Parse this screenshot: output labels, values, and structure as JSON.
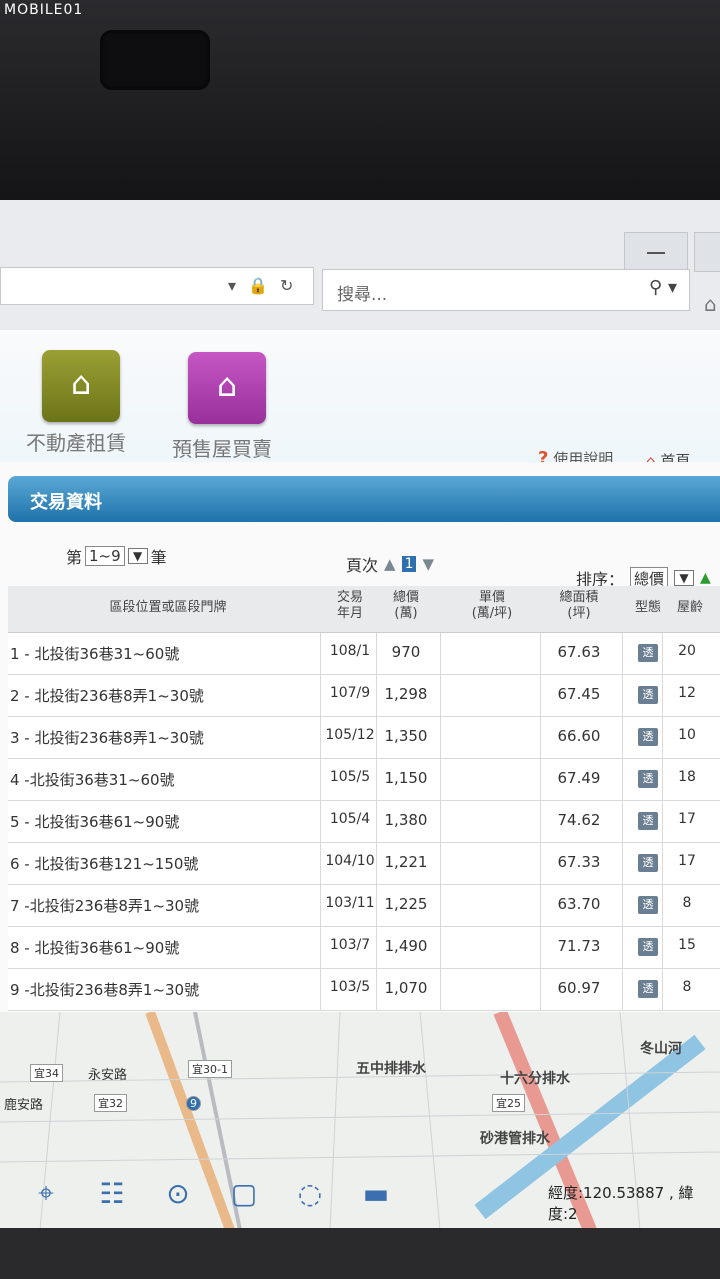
{
  "watermark": "MOBILE01",
  "browser": {
    "search_placeholder": "搜尋..."
  },
  "header": {
    "tiles": [
      {
        "label": "不動產租賃",
        "icon": "house-rent-icon"
      },
      {
        "label": "預售屋買賣",
        "icon": "presale-building-icon"
      }
    ],
    "help_label": "使用說明",
    "home_label": "首頁"
  },
  "panel": {
    "title": "交易資料",
    "pager": {
      "prefix": "第",
      "range": "1~9",
      "suffix": "筆",
      "page_label": "頁次",
      "current_page": "1"
    },
    "sort": {
      "label": "排序：",
      "value": "總價"
    }
  },
  "table": {
    "headers": {
      "location": "區段位置或區段門牌",
      "date": "交易\n年月",
      "total_price": "總價\n(萬)",
      "unit_price": "單價\n(萬/坪)",
      "area": "總面積\n(坪)",
      "type": "型態",
      "age": "屋齡"
    },
    "rows": [
      {
        "location": "1 - 北投街36巷31~60號",
        "date": "108/1",
        "price": "970",
        "unit": "",
        "area": "67.63",
        "type": "透",
        "age": "20"
      },
      {
        "location": "2 - 北投街236巷8弄1~30號",
        "date": "107/9",
        "price": "1,298",
        "unit": "",
        "area": "67.45",
        "type": "透",
        "age": "12"
      },
      {
        "location": "3 - 北投街236巷8弄1~30號",
        "date": "105/12",
        "price": "1,350",
        "unit": "",
        "area": "66.60",
        "type": "透",
        "age": "10"
      },
      {
        "location": "4 -北投街36巷31~60號",
        "date": "105/5",
        "price": "1,150",
        "unit": "",
        "area": "67.49",
        "type": "透",
        "age": "18"
      },
      {
        "location": "5 - 北投街36巷61~90號",
        "date": "105/4",
        "price": "1,380",
        "unit": "",
        "area": "74.62",
        "type": "透",
        "age": "17"
      },
      {
        "location": "6 - 北投街36巷121~150號",
        "date": "104/10",
        "price": "1,221",
        "unit": "",
        "area": "67.33",
        "type": "透",
        "age": "17"
      },
      {
        "location": "7 -北投街236巷8弄1~30號",
        "date": "103/11",
        "price": "1,225",
        "unit": "",
        "area": "63.70",
        "type": "透",
        "age": "8"
      },
      {
        "location": "8 - 北投街36巷61~90號",
        "date": "103/7",
        "price": "1,490",
        "unit": "",
        "area": "71.73",
        "type": "透",
        "age": "15"
      },
      {
        "location": "9 -北投街236巷8弄1~30號",
        "date": "103/5",
        "price": "1,070",
        "unit": "",
        "area": "60.97",
        "type": "透",
        "age": "8"
      }
    ]
  },
  "map": {
    "labels": {
      "yongan": "永安路",
      "luan": "鹿安路",
      "wuzhong": "五中排排水",
      "shiliufen": "十六分排水",
      "shagang": "砂港管排水",
      "dongshan": "冬山河"
    },
    "routes": {
      "r34": "宜34",
      "r30_1": "宜30-1",
      "r32": "宜32",
      "r25": "宜25",
      "r9": "9"
    },
    "coord_text": "經度:120.53887 , 緯度:2"
  },
  "colors": {
    "panel_bar": "#1f73aa",
    "rent_tile": "#8a9128",
    "presale_tile": "#b545b6"
  }
}
